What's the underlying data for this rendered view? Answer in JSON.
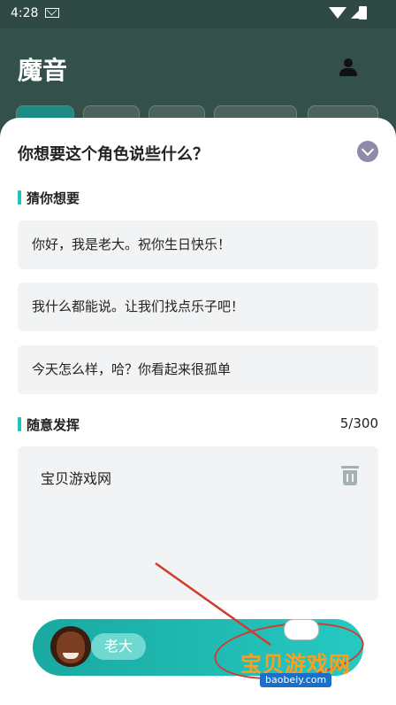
{
  "status_bar": {
    "time": "4:28"
  },
  "app": {
    "title": "魔音"
  },
  "sheet": {
    "title": "你想要这个角色说些什么？",
    "guess_section": {
      "heading": "猜你想要",
      "suggestions": [
        "你好，我是老大。祝你生日快乐！",
        "我什么都能说。让我们找点乐子吧！",
        "今天怎么样，哈？你看起来很孤单"
      ]
    },
    "free_section": {
      "heading": "随意发挥",
      "counter": "5/300",
      "input_value": "宝贝游戏网"
    }
  },
  "bottom_bar": {
    "character_name": "老大"
  },
  "watermark": {
    "text": "宝贝游戏网",
    "url": "baobeiy.com"
  },
  "colors": {
    "accent": "#1fc4b8",
    "sheet_bg": "#ffffff",
    "field_bg": "#f1f3f4",
    "annotation": "#d23b2e"
  }
}
